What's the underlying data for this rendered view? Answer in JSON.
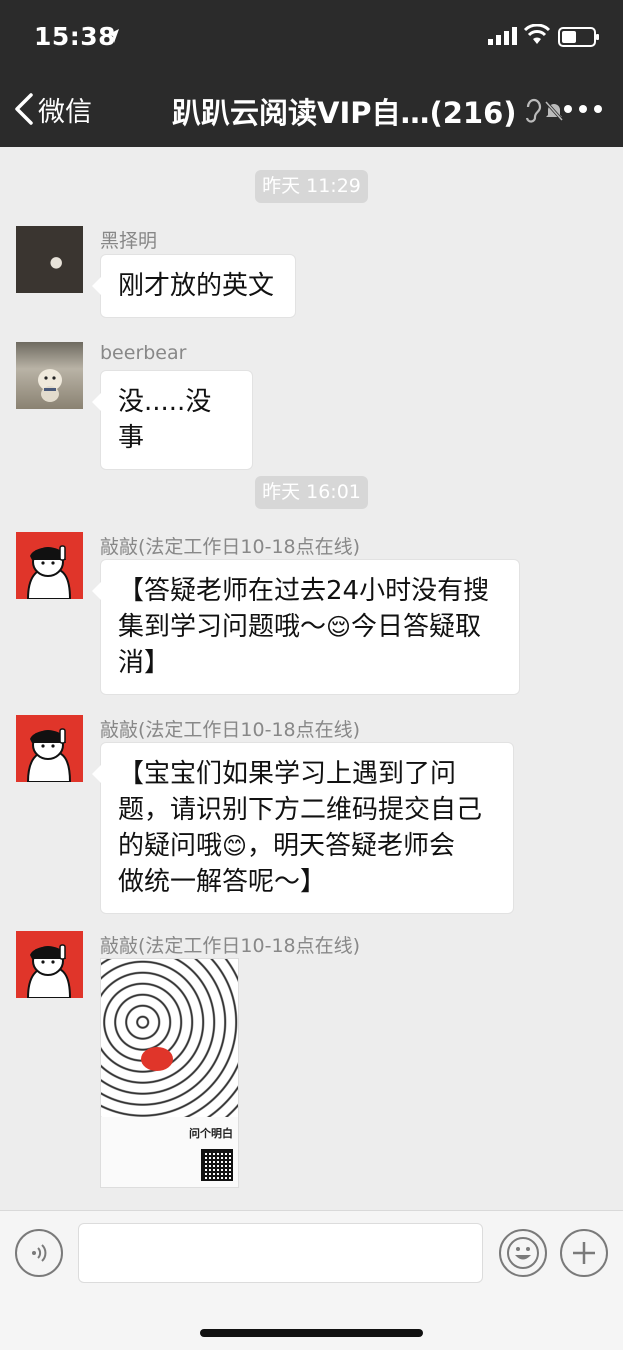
{
  "status_bar": {
    "time": "15:38",
    "location_icon": "location-arrow-icon",
    "signal_icon": "cellular-signal-icon",
    "wifi_icon": "wifi-icon",
    "battery_icon": "battery-icon"
  },
  "nav": {
    "back_label": "微信",
    "title": "趴趴云阅读VIP自…(216)",
    "icons": [
      "ear-icon",
      "mute-icon",
      "more-icon"
    ]
  },
  "messages": [
    {
      "type": "timestamp",
      "text": "昨天 11:29"
    },
    {
      "type": "text",
      "sender": "黑择明",
      "avatar": "photo-avatar",
      "text": "刚才放的英文"
    },
    {
      "type": "text",
      "sender": "beerbear",
      "avatar": "dog-photo-avatar",
      "text": "没.....没事"
    },
    {
      "type": "timestamp",
      "text": "昨天 16:01"
    },
    {
      "type": "text",
      "sender": "敲敲(法定工作日10-18点在线)",
      "avatar": "cartoon-red-avatar",
      "line1": "【答疑老师在过去24小时没有搜",
      "line2a": "集到学习问题哦～",
      "emoji": "😌",
      "line2b": "今日答疑取",
      "line3": "消】"
    },
    {
      "type": "text",
      "sender": "敲敲(法定工作日10-18点在线)",
      "avatar": "cartoon-red-avatar",
      "line1": "【宝宝们如果学习上遇到了问",
      "line2": "题，请识别下方二维码提交自己",
      "line3a": "的疑问哦",
      "emoji": "😊",
      "line3b": "，明天答疑老师会",
      "line4": "做统一解答呢～】"
    },
    {
      "type": "image",
      "sender": "敲敲(法定工作日10-18点在线)",
      "avatar": "cartoon-red-avatar",
      "poster_title": "问个明白",
      "poster_logo": "gotcha"
    }
  ],
  "input_bar": {
    "voice_icon": "voice-icon",
    "input_placeholder": "",
    "emoji_icon": "emoji-icon",
    "plus_icon": "plus-icon"
  }
}
